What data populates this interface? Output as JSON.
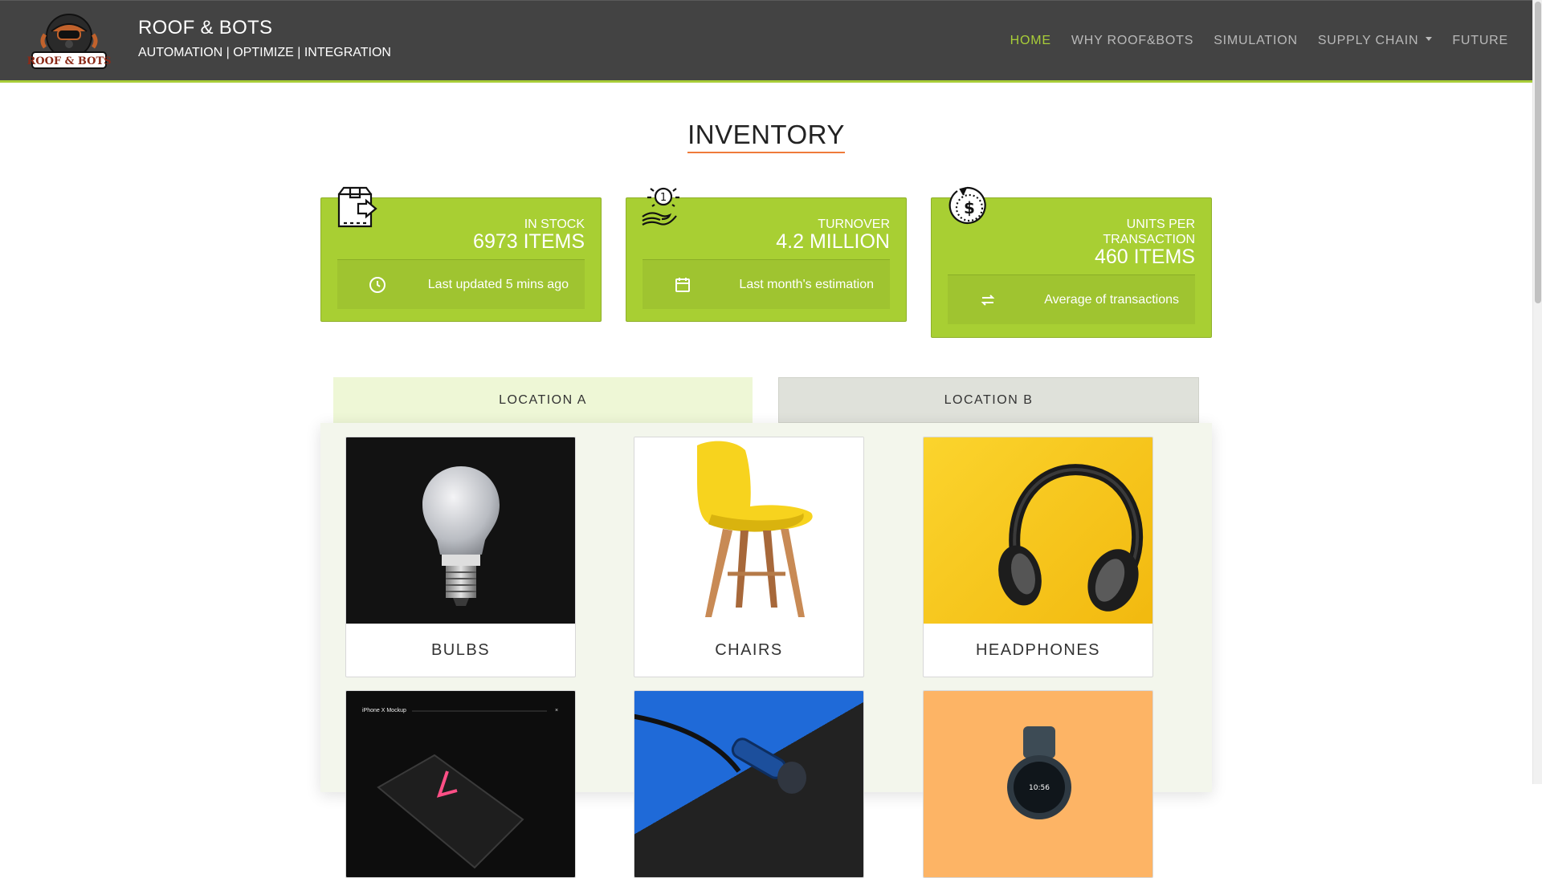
{
  "header": {
    "logo_text": "ROOF & BOTS",
    "title": "ROOF & BOTS",
    "subtitle": "AUTOMATION | OPTIMIZE | INTEGRATION",
    "nav": [
      {
        "label": "HOME",
        "active": true
      },
      {
        "label": "WHY ROOF&BOTS",
        "active": false
      },
      {
        "label": "SIMULATION",
        "active": false
      },
      {
        "label": "SUPPLY CHAIN",
        "active": false,
        "dropdown": true
      },
      {
        "label": "FUTURE",
        "active": false
      }
    ]
  },
  "page": {
    "title": "INVENTORY"
  },
  "stats": [
    {
      "icon": "box-arrow-icon",
      "label": "IN STOCK",
      "value": "6973 ITEMS",
      "footer_icon": "clock-icon",
      "footer_text": "Last updated 5 mins ago"
    },
    {
      "icon": "coin-hand-icon",
      "label": "TURNOVER",
      "value": "4.2 MILLION",
      "footer_icon": "calendar-icon",
      "footer_text": "Last month's estimation"
    },
    {
      "icon": "dollar-cycle-icon",
      "label_line1": "UNITS PER",
      "label_line2": "TRANSACTION",
      "value": "460 ITEMS",
      "footer_icon": "swap-arrows-icon",
      "footer_text": "Average of transactions"
    }
  ],
  "tabs": [
    {
      "label": "LOCATION A",
      "active": true
    },
    {
      "label": "LOCATION B",
      "active": false
    }
  ],
  "products": [
    {
      "name": "BULBS",
      "image": "light-bulb"
    },
    {
      "name": "CHAIRS",
      "image": "yellow-chair"
    },
    {
      "name": "HEADPHONES",
      "image": "headphones"
    },
    {
      "name": "",
      "image": "phone-mockup",
      "image_caption": "iPhone X Mockup"
    },
    {
      "name": "",
      "image": "earphones"
    },
    {
      "name": "",
      "image": "smartwatch",
      "image_caption": "10:56"
    }
  ],
  "colors": {
    "accent_green": "#a8cd38",
    "card_green": "#a8cf33",
    "nav_bg": "#434343",
    "title_underline": "#ef7b3a"
  }
}
